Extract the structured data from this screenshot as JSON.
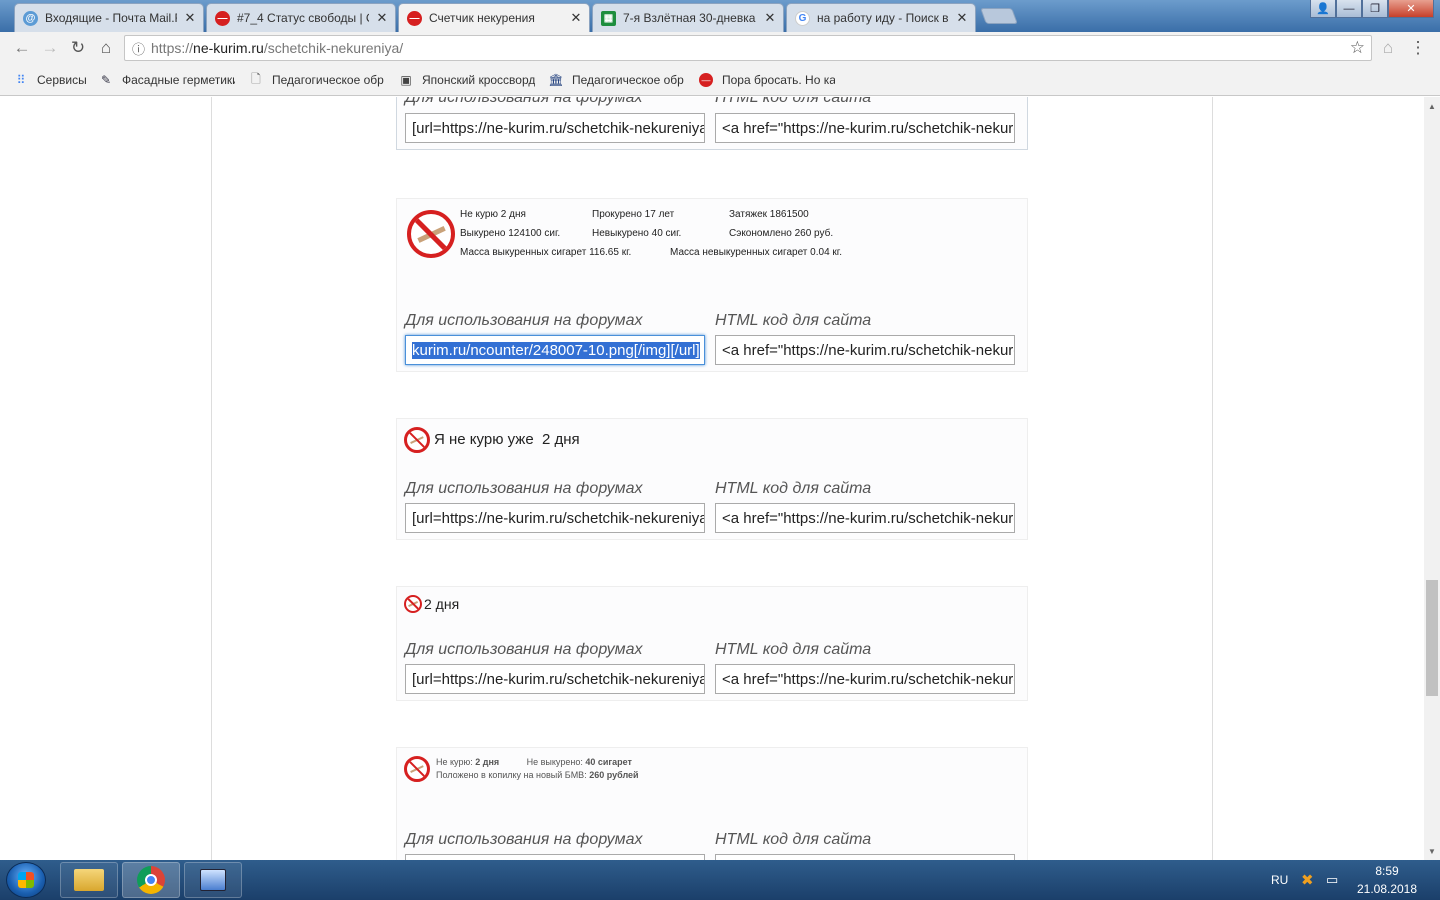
{
  "tabs": [
    {
      "label": "Входящие - Почта Mail.R",
      "icon": "mail-icon",
      "color": "#5b9bd5",
      "close": "✕"
    },
    {
      "label": "#7_4 Статус свободы | С",
      "icon": "no-smoking-icon",
      "color": "#d62020",
      "close": "✕"
    },
    {
      "label": "Счетчик некурения",
      "icon": "no-smoking-icon",
      "color": "#d62020",
      "close": "✕"
    },
    {
      "label": "7-я Взлётная 30-дневка",
      "icon": "sheets-icon",
      "color": "#1e8e3e",
      "close": "✕"
    },
    {
      "label": "на работу иду - Поиск в",
      "icon": "google-icon",
      "color": "#4285f4",
      "close": "✕"
    }
  ],
  "window": {
    "minimize": "—",
    "maximize": "❐",
    "close": "✕",
    "user": "👤"
  },
  "address": {
    "scheme": "https://",
    "host": "ne-kurim.ru",
    "path": "/schetchik-nekureniya/"
  },
  "bookmarks": [
    {
      "label": "Сервисы",
      "icon": "apps-icon"
    },
    {
      "label": "Фасадные герметики",
      "icon": "pen-icon"
    },
    {
      "label": "Педагогическое обр",
      "icon": "page-icon"
    },
    {
      "label": "Японский кроссворд",
      "icon": "puzzle-icon"
    },
    {
      "label": "Педагогическое обр",
      "icon": "institution-icon"
    },
    {
      "label": "Пора бросать. Но ка",
      "icon": "no-smoking-icon"
    }
  ],
  "labels": {
    "forum": "Для использования на форумах",
    "html": "HTML код для сайта"
  },
  "codes": {
    "bbcode": "[url=https://ne-kurim.ru/schetchik-nekureniya",
    "html": "<a href=\"https://ne-kurim.ru/schetchik-nekureniya",
    "bbcode_selected": "kurim.ru/ncounter/248007-10.png[/img][/url]"
  },
  "widget1": {
    "r1c1": "Не курю 2 дня",
    "r1c2": "Прокурено 17 лет",
    "r1c3": "Затяжек 1861500",
    "r2c1": "Выкурено 124100 сиг.",
    "r2c2": "Невыкурено 40 сиг.",
    "r2c3": "Сэкономлено 260 руб.",
    "r3c1": "Масса выкуренных сигарет 116.65 кг.",
    "r3c2": "Масса невыкуренных сигарет 0.04 кг."
  },
  "widget2": {
    "text": "Я не курю уже",
    "value": "2 дня"
  },
  "widget3": {
    "text": "2 дня"
  },
  "widget4": {
    "l1a": "Не курю:",
    "l1b": "2 дня",
    "l1c": "Не выкурено:",
    "l1d": "40 сигарет",
    "l2a": "Положено в копилку на новый БМВ:",
    "l2b": "260 рублей"
  },
  "taskbar": {
    "lang": "RU",
    "time": "8:59",
    "date": "21.08.2018"
  }
}
